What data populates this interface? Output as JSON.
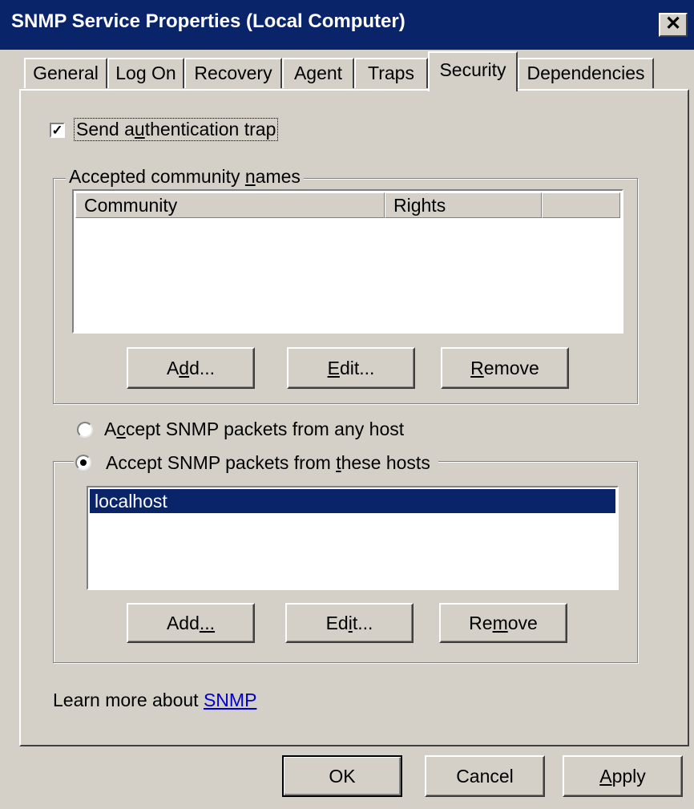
{
  "window": {
    "title": "SNMP Service Properties (Local Computer)",
    "close_glyph": "✕"
  },
  "tabs": [
    {
      "label": "General"
    },
    {
      "label": "Log On"
    },
    {
      "label": "Recovery"
    },
    {
      "label": "Agent"
    },
    {
      "label": "Traps"
    },
    {
      "label": "Security",
      "active": true
    },
    {
      "label": "Dependencies"
    }
  ],
  "security": {
    "auth_trap": {
      "pre": "Send a",
      "u": "u",
      "post": "thentication trap",
      "checked": true
    },
    "community": {
      "group_label": {
        "pre": "Accepted community ",
        "u": "n",
        "post": "ames"
      },
      "columns": [
        "Community",
        "Rights",
        ""
      ],
      "rows": [],
      "add": {
        "pre": "A",
        "u": "d",
        "post": "d..."
      },
      "edit": {
        "pre": "",
        "u": "E",
        "post": "dit..."
      },
      "remove": {
        "pre": "",
        "u": "R",
        "post": "emove"
      }
    },
    "radio_any": {
      "pre": "A",
      "u": "c",
      "post": "cept SNMP packets from any host",
      "selected": false
    },
    "radio_these": {
      "pre": "Accept SNMP packets from ",
      "u": "t",
      "post": "hese hosts",
      "selected": true
    },
    "hosts": {
      "items": [
        "localhost"
      ],
      "selected_index": 0,
      "add": {
        "pre": "Add",
        "u": "...",
        "post": ""
      },
      "edit": {
        "pre": "Ed",
        "u": "i",
        "post": "t..."
      },
      "remove": {
        "pre": "Re",
        "u": "m",
        "post": "ove"
      }
    },
    "learn_more": {
      "text": "Learn more about ",
      "link": "SNMP"
    }
  },
  "footer": {
    "ok": "OK",
    "cancel": "Cancel",
    "apply": {
      "pre": "",
      "u": "A",
      "post": "pply"
    }
  },
  "colors": {
    "titlebar": "#0a246a",
    "dialog_bg": "#d4d0c8",
    "selection": "#0a246a",
    "link": "#0000cc"
  }
}
